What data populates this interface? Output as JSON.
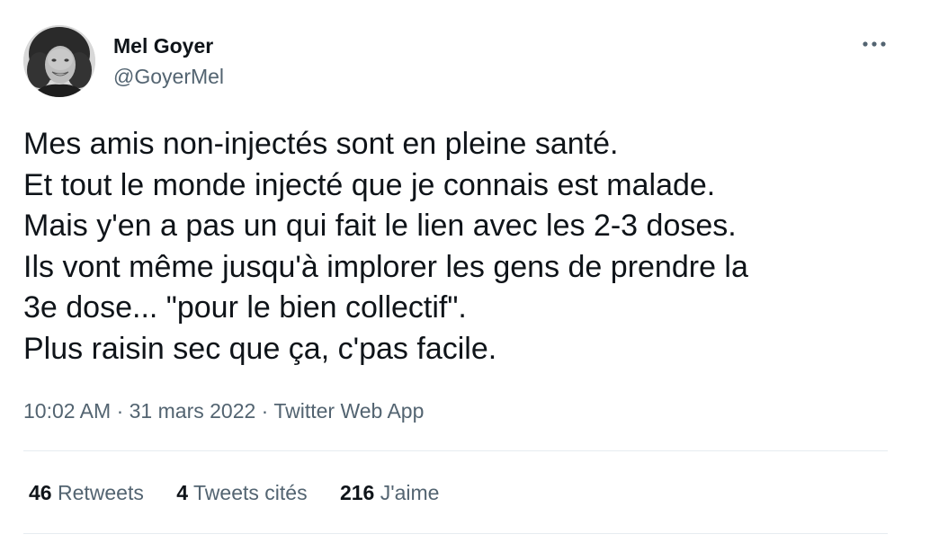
{
  "author": {
    "display_name": "Mel Goyer",
    "handle": "@GoyerMel",
    "avatar_icon": "profile-photo-avatar"
  },
  "menu": {
    "icon": "more-horizontal-icon"
  },
  "tweet": {
    "lines": [
      "Mes amis non-injectés sont en pleine santé.",
      "Et tout le monde injecté que je connais est malade.",
      "Mais y'en a pas un qui fait le lien avec les 2-3 doses.",
      "Ils vont même jusqu'à implorer les gens de prendre la",
      "3e dose... \"pour le bien collectif\".",
      "Plus raisin sec que ça, c'pas facile."
    ]
  },
  "meta": {
    "time": "10:02 AM",
    "separator": "·",
    "date": "31 mars 2022",
    "source": "Twitter Web App"
  },
  "stats": {
    "retweets": {
      "count": "46",
      "label": "Retweets"
    },
    "quotes": {
      "count": "4",
      "label": "Tweets cités"
    },
    "likes": {
      "count": "216",
      "label": "J'aime"
    }
  },
  "colors": {
    "text_primary": "#0f1419",
    "text_secondary": "#536471",
    "divider": "#e6ecf0",
    "background": "#ffffff"
  }
}
